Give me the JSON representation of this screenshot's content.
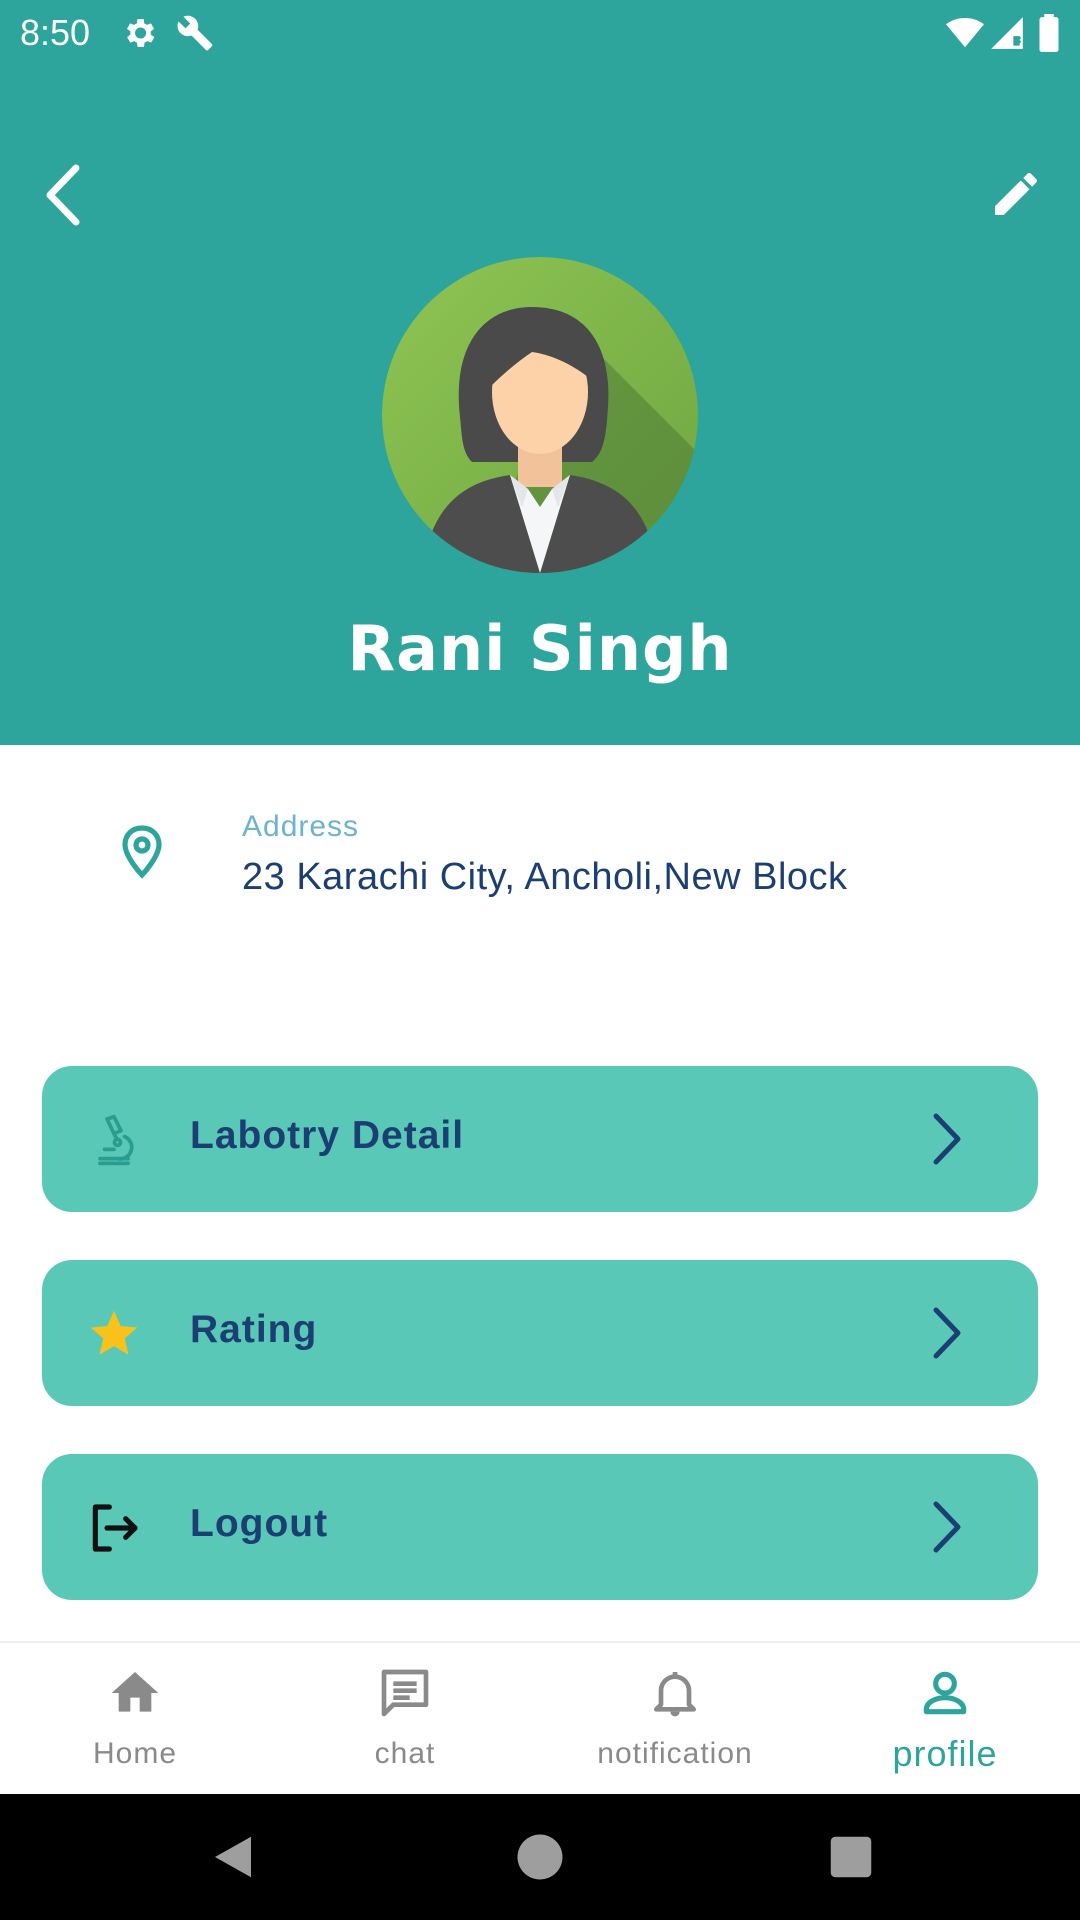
{
  "status_bar": {
    "time": "8:50",
    "left_icons": [
      "gear-icon",
      "wrench-icon"
    ],
    "right_icons": [
      "wifi-icon",
      "signal-icon",
      "battery-icon"
    ]
  },
  "header": {
    "back_icon": "chevron-left-icon",
    "edit_icon": "pencil-icon",
    "user_name": "Rani Singh",
    "background_color": "#2da59c"
  },
  "address": {
    "icon": "location-pin-icon",
    "label": "Address",
    "value": "23 Karachi City, Ancholi,New Block"
  },
  "menu": [
    {
      "label": "Labotry Detail",
      "icon": "microscope-icon"
    },
    {
      "label": "Rating",
      "icon": "star-icon"
    },
    {
      "label": "Logout",
      "icon": "logout-icon"
    }
  ],
  "bottom_nav": {
    "items": [
      {
        "label": "Home",
        "icon": "home-icon",
        "active": false
      },
      {
        "label": "chat",
        "icon": "chat-icon",
        "active": false
      },
      {
        "label": "notification",
        "icon": "bell-icon",
        "active": false
      },
      {
        "label": "profile",
        "icon": "person-icon",
        "active": true
      }
    ]
  },
  "colors": {
    "primary": "#2da59c",
    "card": "#5ac8b7",
    "text_dark": "#1c3f73",
    "label_light": "#6bb3cf",
    "star": "#f9c21a"
  }
}
